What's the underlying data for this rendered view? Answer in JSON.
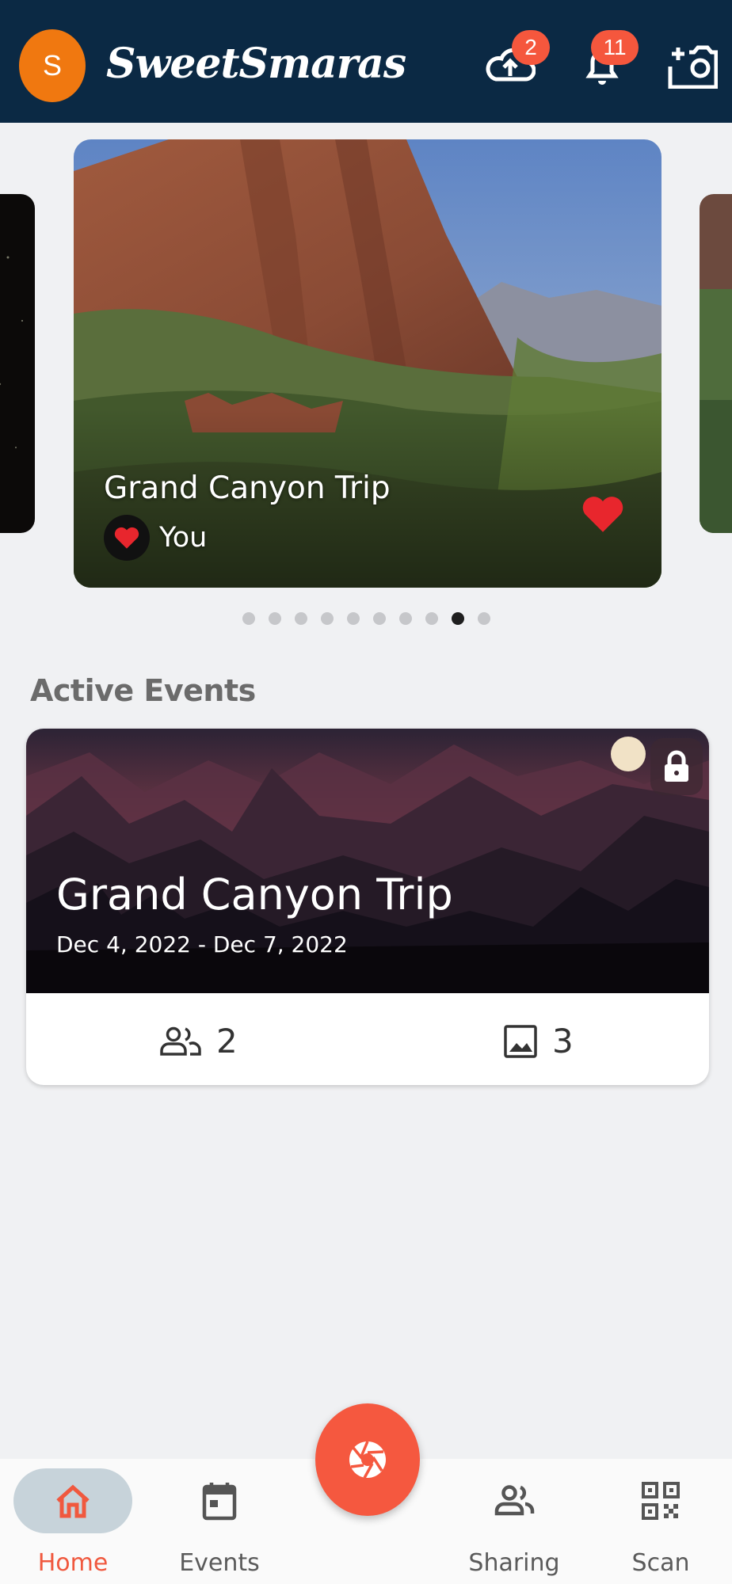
{
  "header": {
    "avatar_letter": "S",
    "brand": "SweetSmaras",
    "upload_badge": "2",
    "notification_badge": "11"
  },
  "carousel": {
    "title": "Grand Canyon Trip",
    "user": "You",
    "dot_count": 10,
    "active_dot": 8
  },
  "active_events": {
    "heading": "Active Events",
    "event": {
      "title": "Grand Canyon Trip",
      "dates": "Dec 4, 2022 - Dec 7, 2022",
      "members": "2",
      "photos": "3"
    }
  },
  "nav": {
    "home": "Home",
    "events": "Events",
    "sharing": "Sharing",
    "scan": "Scan"
  },
  "colors": {
    "header_bg": "#0b2944",
    "accent": "#f5583f",
    "avatar": "#f07810"
  }
}
